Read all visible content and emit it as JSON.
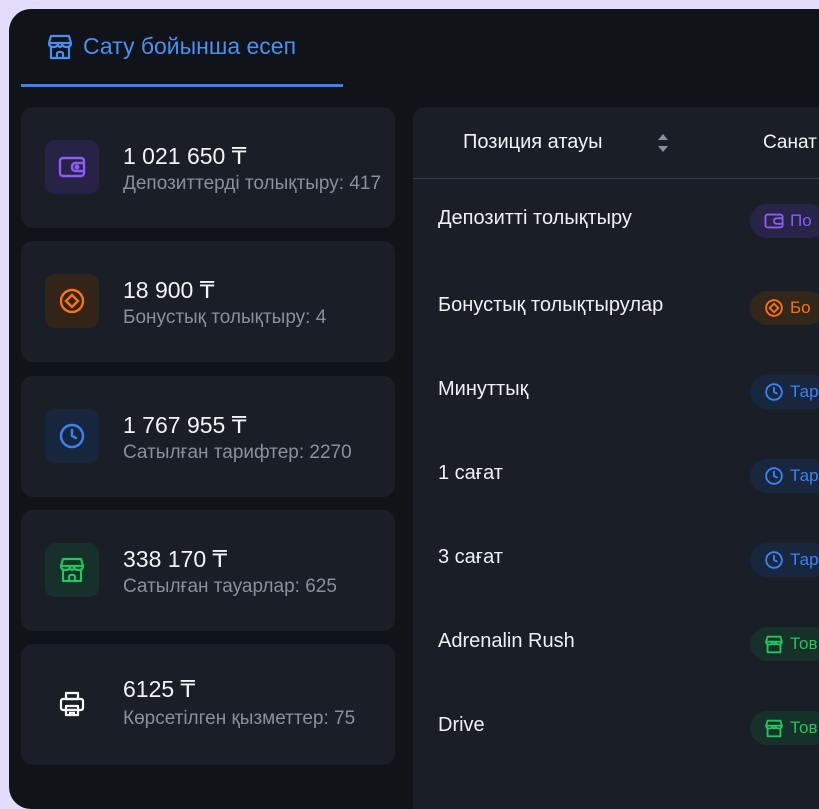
{
  "header": {
    "tab_label": "Сату бойынша есеп",
    "tab_icon": "store-icon",
    "accent": "#3b82f6"
  },
  "stats": [
    {
      "amount": "1 021 650 ₸",
      "label": "Депозиттерді толықтыру: 417",
      "icon": "wallet-icon",
      "color": "#8b5cf6"
    },
    {
      "amount": "18 900 ₸",
      "label": "Бонустық толықтыру: 4",
      "icon": "diamond-icon",
      "color": "#f97316"
    },
    {
      "amount": "1 767 955 ₸",
      "label": "Сатылған тарифтер: 2270",
      "icon": "clock-icon",
      "color": "#3b82f6"
    },
    {
      "amount": "338 170 ₸",
      "label": "Сатылған тауарлар: 625",
      "icon": "store-icon",
      "color": "#22c55e"
    },
    {
      "amount": "6125 ₸",
      "label": "Көрсетілген қызметтер: 75",
      "icon": "printer-icon",
      "color": "#ffffff"
    }
  ],
  "table": {
    "columns": [
      "Позиция атауы",
      "Санат"
    ],
    "rows": [
      {
        "name": "Депозитті толықтыру",
        "category": "По",
        "category_icon": "wallet-icon"
      },
      {
        "name": "Бонустық толықтырулар",
        "category": "Бо",
        "category_icon": "diamond-icon"
      },
      {
        "name": "Минуттық",
        "category": "Тар",
        "category_icon": "clock-icon"
      },
      {
        "name": "1 сағат",
        "category": "Тар",
        "category_icon": "clock-icon"
      },
      {
        "name": "3 сағат",
        "category": "Тар",
        "category_icon": "clock-icon"
      },
      {
        "name": "Adrenalin Rush",
        "category": "Тов",
        "category_icon": "store-icon"
      },
      {
        "name": "Drive",
        "category": "Тов",
        "category_icon": "store-icon"
      }
    ]
  }
}
